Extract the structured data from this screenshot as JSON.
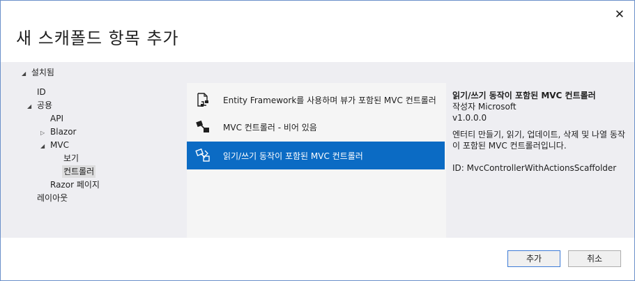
{
  "dialog": {
    "title": "새 스캐폴드 항목 추가",
    "close_glyph": "✕"
  },
  "installed": {
    "label": "설치됨",
    "expand_glyph": "◢"
  },
  "tree": {
    "id_label": "ID",
    "common_label": "공용",
    "common_glyph": "◢",
    "api_label": "API",
    "blazor_label": "Blazor",
    "blazor_glyph": "▷",
    "mvc_label": "MVC",
    "mvc_glyph": "◢",
    "view_label": "보기",
    "controller_label": "컨트롤러",
    "razor_label": "Razor 페이지",
    "layout_label": "레이아웃"
  },
  "templates": [
    {
      "label": "Entity Framework를 사용하며 뷰가 포함된 MVC 컨트롤러",
      "icon": "controller-ef-icon"
    },
    {
      "label": "MVC 컨트롤러 - 비어 있음",
      "icon": "controller-empty-icon"
    },
    {
      "label": "읽기/쓰기 동작이 포함된 MVC 컨트롤러",
      "icon": "controller-actions-icon"
    }
  ],
  "selected_template_index": 2,
  "details": {
    "name": "읽기/쓰기 동작이 포함된 MVC 컨트롤러",
    "author": "작성자 Microsoft",
    "version": "v1.0.0.0",
    "description": "엔터티 만들기, 읽기, 업데이트, 삭제 및 나열 동작이 포함된 MVC 컨트롤러입니다.",
    "id": "ID: MvcControllerWithActionsScaffolder"
  },
  "buttons": {
    "add": "추가",
    "cancel": "취소"
  },
  "colors": {
    "selection": "#0b6bc4",
    "panel": "#eeeef2",
    "accent_border": "#3d7bd6"
  }
}
